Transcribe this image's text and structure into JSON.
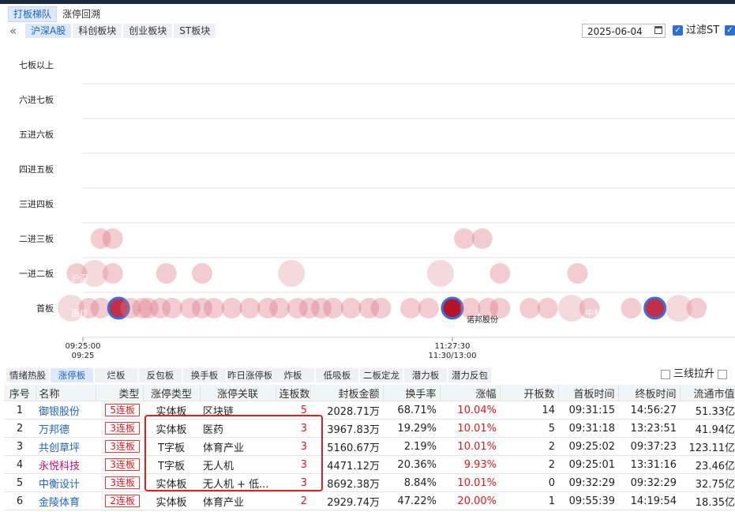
{
  "top_tabs": [
    {
      "label": "打板梯队",
      "active": true
    },
    {
      "label": "涨停回溯",
      "active": false
    }
  ],
  "market_tabs": [
    {
      "label": "沪深A股",
      "active": true
    },
    {
      "label": "科创板块",
      "active": false
    },
    {
      "label": "创业板块",
      "active": false
    },
    {
      "label": "ST板块",
      "active": false
    }
  ],
  "date_value": "2025-06-04",
  "filter_st_label": "过滤ST",
  "chart_data": {
    "type": "scatter",
    "y_categories": [
      "七板以上",
      "六进七板",
      "五进六板",
      "四进五板",
      "三进四板",
      "二进三板",
      "一进二板",
      "首板"
    ],
    "x_ticks": [
      {
        "lines": [
          "09:25:00",
          "09:25"
        ]
      },
      {
        "lines": [
          "11:27:30",
          "11:30/13:00"
        ]
      }
    ],
    "highlight_label": "诺邦股份",
    "bubble_texts": [
      "沪深",
      "医疗",
      "色",
      "新安港",
      "医疗",
      "中科金",
      "财",
      "体育医",
      "疗"
    ],
    "points": [
      {
        "level": "二进三板",
        "t": 0.03
      },
      {
        "level": "二进三板",
        "t": 0.05
      },
      {
        "level": "二进三板",
        "t": 0.64
      },
      {
        "level": "二进三板",
        "t": 0.67
      },
      {
        "level": "一进二板",
        "t": -0.01
      },
      {
        "level": "一进二板",
        "t": 0.02,
        "big": true
      },
      {
        "level": "一进二板",
        "t": 0.05
      },
      {
        "level": "一进二板",
        "t": 0.14
      },
      {
        "level": "一进二板",
        "t": 0.2
      },
      {
        "level": "一进二板",
        "t": 0.35,
        "big": true
      },
      {
        "level": "一进二板",
        "t": 0.6,
        "big": true
      },
      {
        "level": "一进二板",
        "t": 0.7
      },
      {
        "level": "一进二板",
        "t": 0.83
      },
      {
        "level": "首板",
        "t": -0.02,
        "big": true
      },
      {
        "level": "首板",
        "t": 0.01
      },
      {
        "level": "首板",
        "t": 0.03
      },
      {
        "level": "首板",
        "t": 0.06,
        "hl": true
      },
      {
        "level": "首板",
        "t": 0.08
      },
      {
        "level": "首板",
        "t": 0.1
      },
      {
        "level": "首板",
        "t": 0.11
      },
      {
        "level": "首板",
        "t": 0.13
      },
      {
        "level": "首板",
        "t": 0.15
      },
      {
        "level": "首板",
        "t": 0.18
      },
      {
        "level": "首板",
        "t": 0.2
      },
      {
        "level": "首板",
        "t": 0.22
      },
      {
        "level": "首板",
        "t": 0.25
      },
      {
        "level": "首板",
        "t": 0.28
      },
      {
        "level": "首板",
        "t": 0.31
      },
      {
        "level": "首板",
        "t": 0.33
      },
      {
        "level": "首板",
        "t": 0.36
      },
      {
        "level": "首板",
        "t": 0.38
      },
      {
        "level": "首板",
        "t": 0.4
      },
      {
        "level": "首板",
        "t": 0.42
      },
      {
        "level": "首板",
        "t": 0.45
      },
      {
        "level": "首板",
        "t": 0.48
      },
      {
        "level": "首板",
        "t": 0.5
      },
      {
        "level": "首板",
        "t": 0.55
      },
      {
        "level": "首板",
        "t": 0.58
      },
      {
        "level": "首板",
        "t": 0.62,
        "hl": true,
        "dark": true
      },
      {
        "level": "首板",
        "t": 0.65
      },
      {
        "level": "首板",
        "t": 0.68
      },
      {
        "level": "首板",
        "t": 0.7
      },
      {
        "level": "首板",
        "t": 0.75
      },
      {
        "level": "首板",
        "t": 0.78
      },
      {
        "level": "首板",
        "t": 0.82,
        "big": true
      },
      {
        "level": "首板",
        "t": 0.85
      },
      {
        "level": "首板",
        "t": 0.92
      },
      {
        "level": "首板",
        "t": 0.96,
        "hl": true
      },
      {
        "level": "首板",
        "t": 1.0,
        "big": true
      },
      {
        "level": "首板",
        "t": 1.03
      }
    ]
  },
  "list_tabs": [
    {
      "label": "情绪热股",
      "active": false
    },
    {
      "label": "涨停板",
      "active": true
    },
    {
      "label": "烂板",
      "active": false
    },
    {
      "label": "反包板",
      "active": false
    },
    {
      "label": "换手板",
      "active": false
    },
    {
      "label": "昨日涨停板",
      "active": false
    },
    {
      "label": "炸板",
      "active": false
    },
    {
      "label": "低吸板",
      "active": false
    },
    {
      "label": "二板定龙",
      "active": false
    },
    {
      "label": "潜力板",
      "active": false
    },
    {
      "label": "潜力反包",
      "active": false
    }
  ],
  "three_line_label": "三线拉升",
  "table": {
    "headers": [
      "序号",
      "名称",
      "类型",
      "涨停类型",
      "涨停关联",
      "连板数",
      "封板金额",
      "换手率",
      "涨幅",
      "开板数",
      "首板时间",
      "终板时间",
      "流通市值"
    ],
    "rows": [
      {
        "idx": "1",
        "name": "御银股份",
        "name_color": "blue",
        "type": "5连板",
        "ztype": "实体板",
        "rel": "区块链",
        "lb": "5",
        "amount": "2028.71万",
        "turnover": "68.71%",
        "chg": "10.04%",
        "open": "14",
        "first": "09:31:15",
        "last": "14:56:27",
        "cap": "51.33亿"
      },
      {
        "idx": "2",
        "name": "万邦德",
        "name_color": "blue",
        "type": "3连板",
        "ztype": "实体板",
        "rel": "医药",
        "lb": "3",
        "amount": "3967.83万",
        "turnover": "19.29%",
        "chg": "10.01%",
        "open": "5",
        "first": "09:31:18",
        "last": "13:23:51",
        "cap": "41.94亿"
      },
      {
        "idx": "3",
        "name": "共创草坪",
        "name_color": "blue",
        "type": "3连板",
        "ztype": "T字板",
        "rel": "体育产业",
        "lb": "3",
        "amount": "5160.67万",
        "turnover": "2.19%",
        "chg": "10.01%",
        "open": "2",
        "first": "09:25:02",
        "last": "09:37:23",
        "cap": "123.11亿"
      },
      {
        "idx": "4",
        "name": "永悦科技",
        "name_color": "mag",
        "type": "3连板",
        "ztype": "T字板",
        "rel": "无人机",
        "lb": "3",
        "amount": "4471.12万",
        "turnover": "20.36%",
        "chg": "9.93%",
        "open": "2",
        "first": "09:25:01",
        "last": "13:31:16",
        "cap": "23.46亿"
      },
      {
        "idx": "5",
        "name": "中衡设计",
        "name_color": "blue",
        "type": "3连板",
        "ztype": "实体板",
        "rel": "无人机 + 低...",
        "lb": "3",
        "amount": "8692.38万",
        "turnover": "8.84%",
        "chg": "10.01%",
        "open": "0",
        "first": "09:32:29",
        "last": "09:32:29",
        "cap": "32.75亿"
      },
      {
        "idx": "6",
        "name": "金陵体育",
        "name_color": "blue",
        "type": "2连板",
        "ztype": "实体板",
        "rel": "体育产业",
        "lb": "2",
        "amount": "2929.74万",
        "turnover": "47.22%",
        "chg": "20.00%",
        "open": "1",
        "first": "09:55:39",
        "last": "14:19:54",
        "cap": "18.35亿"
      }
    ]
  }
}
